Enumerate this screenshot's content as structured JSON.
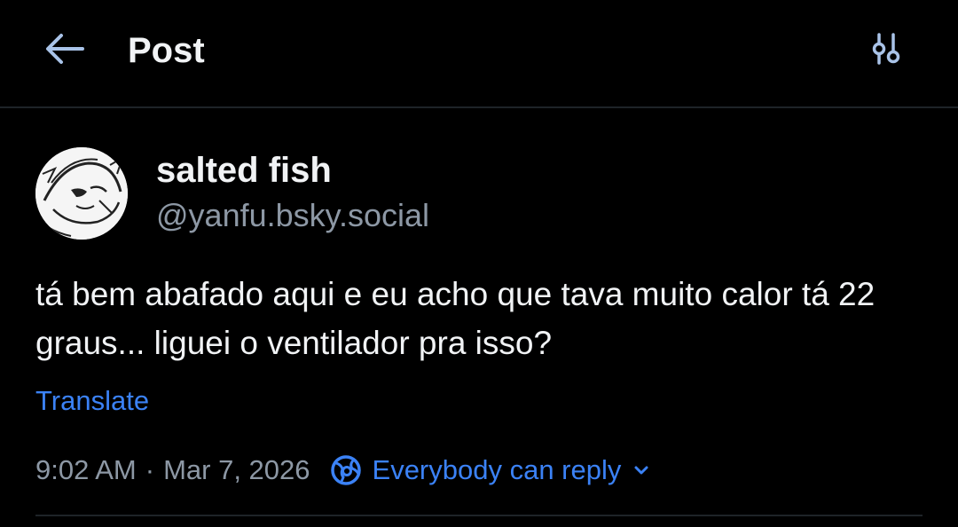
{
  "header": {
    "title": "Post",
    "back_icon": "arrow-left-icon",
    "settings_icon": "sliders-icon"
  },
  "author": {
    "display_name": "salted fish",
    "handle": "@yanfu.bsky.social",
    "avatar_icon": "avatar-image"
  },
  "post": {
    "text": "tá bem abafado aqui e eu acho que tava muito calor tá 22 graus... liguei o ventilador pra isso?",
    "translate_label": "Translate",
    "time": "9:02 AM",
    "separator": "·",
    "date": "Mar 7, 2026",
    "reply_setting_label": "Everybody can reply",
    "reply_setting_icon": "globe-icon"
  },
  "colors": {
    "background": "#000000",
    "text_primary": "#f1f3f5",
    "text_secondary": "#8d98a5",
    "accent": "#3b82f6",
    "divider": "#1e2328"
  }
}
